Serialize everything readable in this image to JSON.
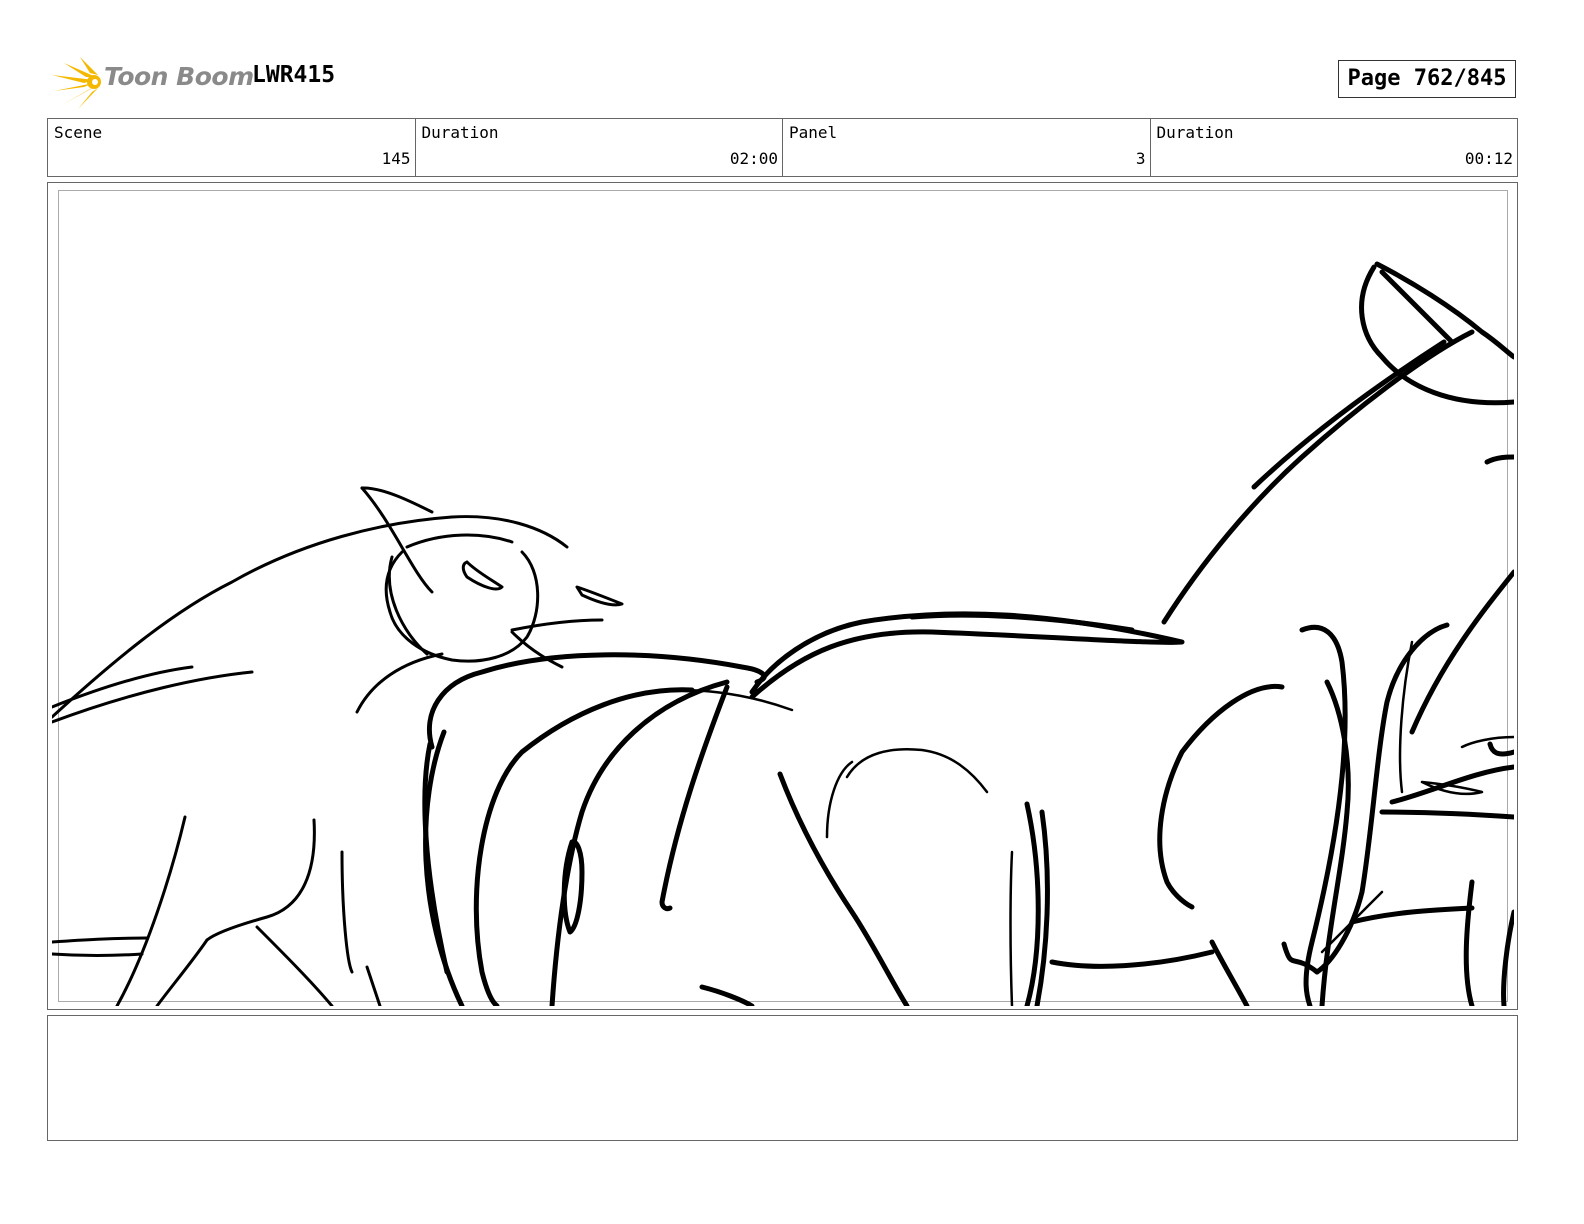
{
  "header": {
    "logo_text": "Toon Boom",
    "project_code": "LWR415",
    "page_label": "Page 762/845"
  },
  "info": {
    "scene_label": "Scene",
    "scene_value": "145",
    "scene_duration_label": "Duration",
    "scene_duration_value": "02:00",
    "panel_label": "Panel",
    "panel_value": "3",
    "panel_duration_label": "Duration",
    "panel_duration_value": "00:12"
  },
  "panel": {
    "image_description_icon": "sketch-drawing"
  },
  "notes": {
    "text": ""
  },
  "colors": {
    "logo_star": "#f5b800",
    "logo_text": "#8a8a8a",
    "border": "#666666"
  }
}
